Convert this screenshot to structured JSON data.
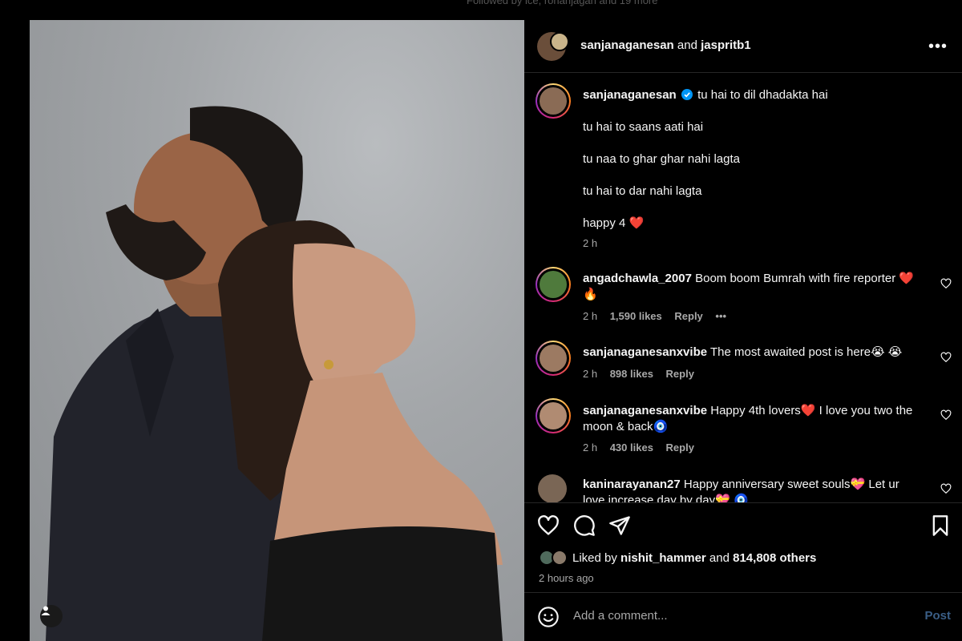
{
  "top": {
    "followed_text": "Followed by lce, rohanjagan and 19 more"
  },
  "header": {
    "user1": "sanjanaganesan",
    "and": "and",
    "user2": "jaspritb1",
    "more": "•••"
  },
  "caption": {
    "user": "sanjanaganesan",
    "lines": [
      "tu hai to dil dhadakta hai",
      "tu hai to saans aati hai",
      "tu naa to ghar ghar nahi lagta",
      "tu hai to dar nahi lagta",
      "happy 4 ❤️"
    ],
    "time": "2 h"
  },
  "comments": [
    {
      "user": "angadchawla_2007",
      "text": "Boom boom Bumrah with fire reporter ❤️ 🔥",
      "time": "2 h",
      "likes": "1,590 likes",
      "reply": "Reply",
      "more": "•••"
    },
    {
      "user": "sanjanaganesanxvibe",
      "text": "The most awaited post is here😭 😭",
      "time": "2 h",
      "likes": "898 likes",
      "reply": "Reply"
    },
    {
      "user": "sanjanaganesanxvibe",
      "text": "Happy 4th lovers❤️  I love you two the moon & back🧿",
      "time": "2 h",
      "likes": "430 likes",
      "reply": "Reply"
    },
    {
      "user": "kaninarayanan27",
      "text": "Happy anniversary sweet souls💝 Let ur love increase day by day💝 🧿"
    }
  ],
  "likes": {
    "prefix": "Liked by",
    "user": "nishit_hammer",
    "and": "and",
    "count": "814,808 others"
  },
  "posted": "2 hours ago",
  "add_comment": {
    "placeholder": "Add a comment...",
    "post": "Post"
  },
  "colors": {
    "accent": "#0095f6",
    "bg": "#000000",
    "muted": "#a8a8a8",
    "heart": "#ed4956"
  },
  "icons": [
    "heart-icon",
    "comment-icon",
    "share-icon",
    "bookmark-icon",
    "emoji-icon",
    "user-tag-icon",
    "verified-icon"
  ]
}
